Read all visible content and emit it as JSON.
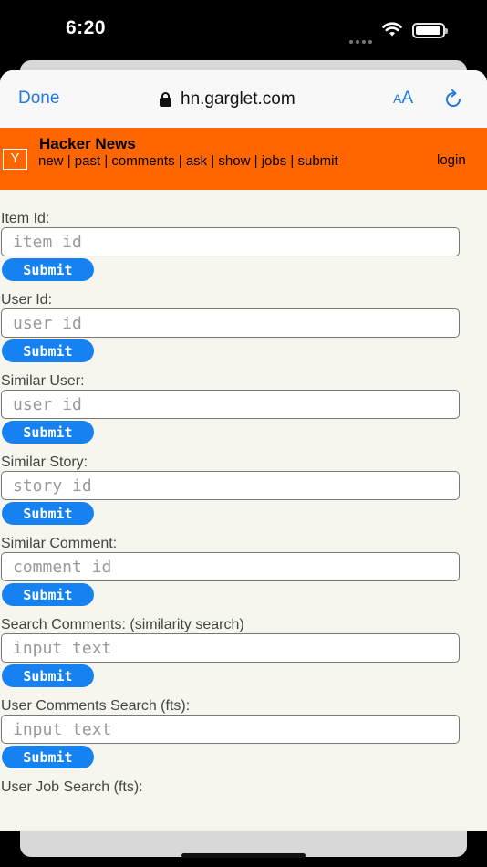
{
  "status_bar": {
    "time": "6:20"
  },
  "browser": {
    "done_label": "Done",
    "url": "hn.garglet.com",
    "aa_small": "A",
    "aa_big": "A"
  },
  "hn": {
    "logo": "Y",
    "title": "Hacker News",
    "nav": [
      "new",
      "past",
      "comments",
      "ask",
      "show",
      "jobs",
      "submit"
    ],
    "separator": "|",
    "login": "login",
    "brand_color": "#ff6600"
  },
  "form": {
    "submit_label": "Submit",
    "sections": [
      {
        "label": "Item Id:",
        "placeholder": "item id"
      },
      {
        "label": "User Id:",
        "placeholder": "user id"
      },
      {
        "label": "Similar User:",
        "placeholder": "user id"
      },
      {
        "label": "Similar Story:",
        "placeholder": "story id"
      },
      {
        "label": "Similar Comment:",
        "placeholder": "comment id"
      },
      {
        "label": "Search Comments: (similarity search)",
        "placeholder": "input text"
      },
      {
        "label": "User Comments Search (fts):",
        "placeholder": "input text"
      },
      {
        "label": "User Job Search (fts):",
        "placeholder": ""
      }
    ]
  },
  "toolbar": {
    "icons": [
      "back-icon",
      "forward-icon",
      "share-icon",
      "compass-icon"
    ],
    "accent": "#1f7ae6"
  }
}
